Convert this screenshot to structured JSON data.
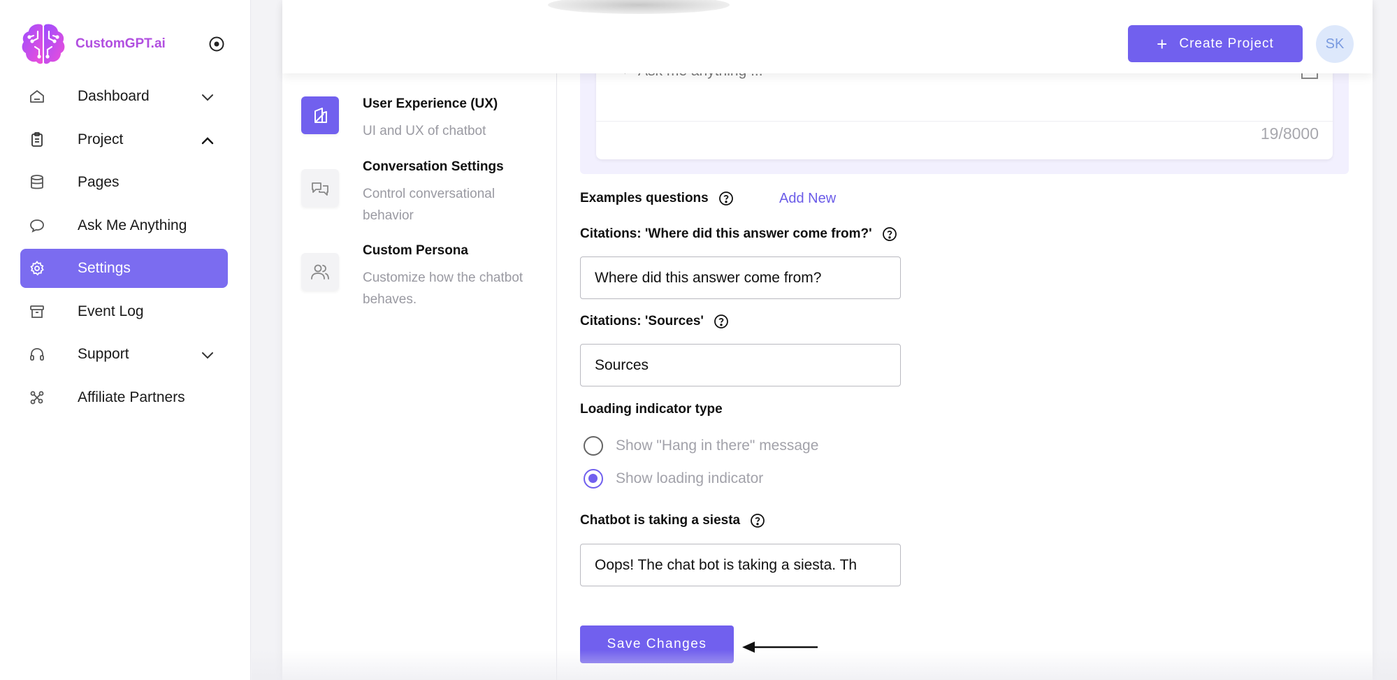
{
  "brand": {
    "name": "CustomGPT.ai"
  },
  "sidebar": {
    "items": [
      {
        "label": "Dashboard",
        "icon": "home-icon",
        "chevron": "down"
      },
      {
        "label": "Project",
        "icon": "clipboard-icon",
        "chevron": "up"
      },
      {
        "label": "Pages",
        "icon": "database-icon"
      },
      {
        "label": "Ask Me Anything",
        "icon": "chat-bubble-icon"
      },
      {
        "label": "Settings",
        "icon": "gear-icon",
        "active": true
      },
      {
        "label": "Event Log",
        "icon": "archive-icon"
      },
      {
        "label": "Support",
        "icon": "headphones-icon",
        "chevron": "down"
      },
      {
        "label": "Affiliate Partners",
        "icon": "network-icon"
      }
    ]
  },
  "header": {
    "create_label": "Create Project",
    "avatar_initials": "SK"
  },
  "settings_nav": [
    {
      "title": "User Experience (UX)",
      "description": "UI and UX of chatbot",
      "icon": "layout-icon",
      "active": true
    },
    {
      "title": "Conversation Settings",
      "description": "Control conversational behavior",
      "icon": "conversation-icon"
    },
    {
      "title": "Custom Persona",
      "description": "Customize how the chatbot behaves.",
      "icon": "users-icon"
    }
  ],
  "preview": {
    "placeholder": "Ask me anything ...",
    "counter": "19/8000"
  },
  "form": {
    "examples_label": "Examples questions",
    "add_new": "Add New",
    "citation_question_label": "Citations: 'Where did this answer come from?'",
    "citation_question_value": "Where did this answer come from?",
    "citation_sources_label": "Citations: 'Sources'",
    "citation_sources_value": "Sources",
    "loading_label": "Loading indicator type",
    "loading_options": [
      {
        "label": "Show \"Hang in there\" message",
        "checked": false
      },
      {
        "label": "Show loading indicator",
        "checked": true
      }
    ],
    "siesta_label": "Chatbot is taking a siesta",
    "siesta_value": "Oops! The chat bot is taking a siesta. Th",
    "save_label": "Save Changes"
  },
  "colors": {
    "accent": "#7160ee",
    "sidebar_active": "#7b6cf0",
    "brand_text": "#b14fe0"
  }
}
